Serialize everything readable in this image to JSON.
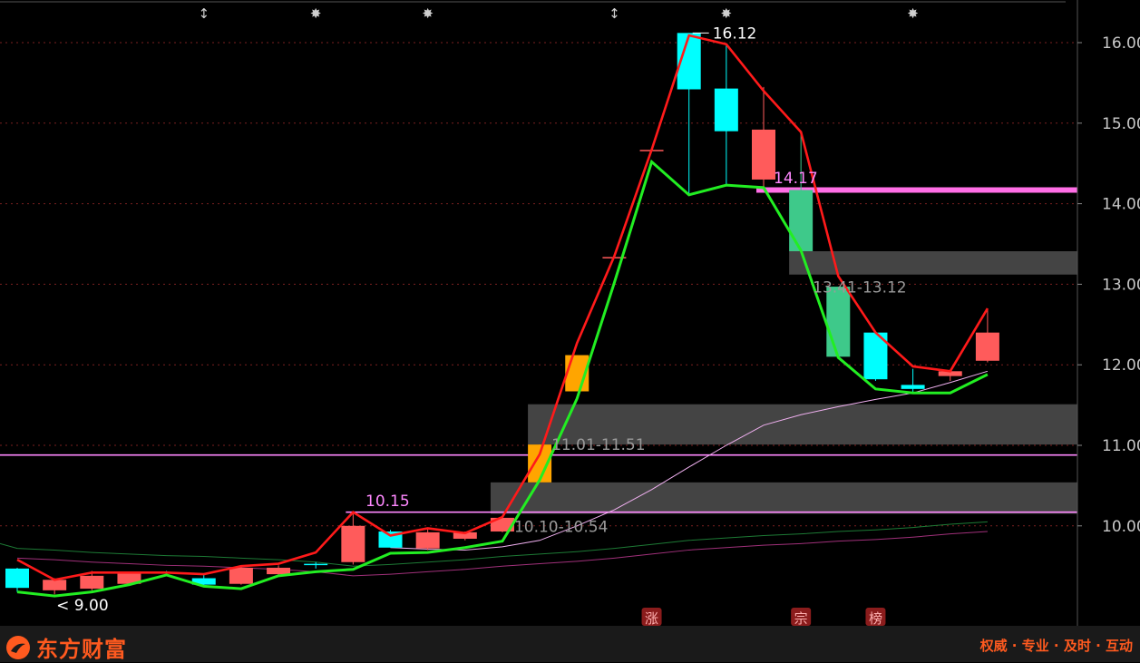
{
  "chart_data": {
    "type": "candlestick",
    "ylim": [
      9.0,
      16.5
    ],
    "y_ticks": [
      "16.00",
      "15.00",
      "14.00",
      "13.00",
      "12.00",
      "11.00",
      "10.00"
    ],
    "y_tick_values": [
      16,
      15,
      14,
      13,
      12,
      11,
      10
    ],
    "candles": [
      {
        "o": 9.23,
        "h": 9.48,
        "l": 9.18,
        "c": 9.47,
        "color": "cyan"
      },
      {
        "o": 9.2,
        "h": 9.35,
        "l": 9.15,
        "c": 9.33,
        "color": "red"
      },
      {
        "o": 9.22,
        "h": 9.44,
        "l": 9.2,
        "c": 9.38,
        "color": "red"
      },
      {
        "o": 9.28,
        "h": 9.42,
        "l": 9.27,
        "c": 9.42,
        "color": "red"
      },
      {
        "o": 9.42,
        "h": 9.44,
        "l": 9.4,
        "c": 9.4,
        "color": "cyan"
      },
      {
        "o": 9.35,
        "h": 9.4,
        "l": 9.24,
        "c": 9.27,
        "color": "cyan"
      },
      {
        "o": 9.28,
        "h": 9.5,
        "l": 9.27,
        "c": 9.48,
        "color": "red"
      },
      {
        "o": 9.4,
        "h": 9.51,
        "l": 9.38,
        "c": 9.48,
        "color": "red"
      },
      {
        "o": 9.52,
        "h": 9.55,
        "l": 9.47,
        "c": 9.5,
        "color": "cyan"
      },
      {
        "o": 9.55,
        "h": 10.15,
        "l": 9.52,
        "c": 10.0,
        "color": "red"
      },
      {
        "o": 9.93,
        "h": 9.95,
        "l": 9.73,
        "c": 9.73,
        "color": "cyan"
      },
      {
        "o": 9.72,
        "h": 9.98,
        "l": 9.7,
        "c": 9.92,
        "color": "red"
      },
      {
        "o": 9.84,
        "h": 9.93,
        "l": 9.82,
        "c": 9.92,
        "color": "red"
      },
      {
        "o": 9.93,
        "h": 10.12,
        "l": 9.92,
        "c": 10.1,
        "color": "red"
      },
      {
        "o": 10.54,
        "h": 11.01,
        "l": 10.54,
        "c": 11.01,
        "color": "orange"
      },
      {
        "o": 11.67,
        "h": 12.12,
        "l": 11.67,
        "c": 12.12,
        "color": "orange"
      },
      {
        "o": 13.33,
        "h": 13.33,
        "l": 13.33,
        "c": 13.33,
        "color": "red"
      },
      {
        "o": 14.66,
        "h": 14.66,
        "l": 14.66,
        "c": 14.66,
        "color": "red"
      },
      {
        "o": 16.12,
        "h": 16.12,
        "l": 14.11,
        "c": 15.42,
        "color": "cyan"
      },
      {
        "o": 15.43,
        "h": 15.98,
        "l": 14.23,
        "c": 14.9,
        "color": "cyan"
      },
      {
        "o": 14.3,
        "h": 15.45,
        "l": 14.2,
        "c": 14.92,
        "color": "red"
      },
      {
        "o": 14.17,
        "h": 14.89,
        "l": 13.41,
        "c": 13.41,
        "color": "green"
      },
      {
        "o": 12.97,
        "h": 12.97,
        "l": 12.1,
        "c": 12.1,
        "color": "green"
      },
      {
        "o": 12.4,
        "h": 12.4,
        "l": 11.8,
        "c": 11.82,
        "color": "cyan"
      },
      {
        "o": 11.75,
        "h": 11.95,
        "l": 11.65,
        "c": 11.7,
        "color": "cyan"
      },
      {
        "o": 11.86,
        "h": 11.92,
        "l": 11.8,
        "c": 11.92,
        "color": "red"
      },
      {
        "o": 12.05,
        "h": 12.7,
        "l": 12.03,
        "c": 12.4,
        "color": "red"
      }
    ],
    "upper_band": [
      9.58,
      9.33,
      9.42,
      9.42,
      9.42,
      9.4,
      9.5,
      9.53,
      9.67,
      10.17,
      9.88,
      9.97,
      9.91,
      10.11,
      10.89,
      12.27,
      13.35,
      14.67,
      16.09,
      15.98,
      15.4,
      14.89,
      13.1,
      12.4,
      11.98,
      11.92,
      12.7
    ],
    "lower_band": [
      9.18,
      9.13,
      9.18,
      9.27,
      9.39,
      9.25,
      9.22,
      9.38,
      9.43,
      9.46,
      9.66,
      9.67,
      9.73,
      9.81,
      10.57,
      11.58,
      13.02,
      14.52,
      14.11,
      14.23,
      14.2,
      13.42,
      12.09,
      11.7,
      11.65,
      11.65,
      11.88
    ],
    "ma_short_start_index": 10,
    "ma_short": [
      9.73,
      9.71,
      9.7,
      9.74,
      9.82,
      10.0,
      10.2,
      10.45,
      10.73,
      11.0,
      11.25,
      11.38,
      11.48,
      11.57,
      11.65,
      11.78,
      11.92
    ],
    "ma_long": [
      9.72,
      9.7,
      9.67,
      9.65,
      9.63,
      9.62,
      9.6,
      9.58,
      9.55,
      9.5,
      9.52,
      9.55,
      9.58,
      9.62,
      9.65,
      9.68,
      9.72,
      9.77,
      9.82,
      9.85,
      9.88,
      9.9,
      9.93,
      9.95,
      9.98,
      10.02,
      10.05
    ],
    "horizontal_lines": [
      {
        "value": 10.88,
        "color": "#ff88ff"
      },
      {
        "value": 10.17,
        "color": "#ff88ff"
      },
      {
        "value": 14.17,
        "color": "#ff6ee6"
      }
    ],
    "zones": [
      {
        "top": 11.51,
        "bottom": 11.01,
        "start_index": 14,
        "label": "11.01-11.51"
      },
      {
        "top": 10.54,
        "bottom": 10.15,
        "start_index": 13,
        "label": "10.10-10.54"
      },
      {
        "top": 13.41,
        "bottom": 13.12,
        "start_index": 21,
        "label": "13.41-13.12"
      }
    ],
    "annotations": [
      {
        "text": "16.12",
        "value": 16.12,
        "index": 18
      },
      {
        "text": "9.00",
        "value": 9.0,
        "index": 1
      },
      {
        "text": "10.15",
        "value": 10.15,
        "index": 9
      },
      {
        "text": "14.17",
        "value": 14.17,
        "index": 20
      }
    ],
    "top_markers": [
      {
        "symbol": "↕",
        "index": 5
      },
      {
        "symbol": "✸",
        "index": 8
      },
      {
        "symbol": "✸",
        "index": 11
      },
      {
        "symbol": "↕",
        "index": 16
      },
      {
        "symbol": "✸",
        "index": 19
      },
      {
        "symbol": "✸",
        "index": 24
      }
    ],
    "bottom_tags": [
      {
        "text": "涨",
        "index": 17
      },
      {
        "text": "宗",
        "index": 21
      },
      {
        "text": "榜",
        "index": 23
      }
    ]
  },
  "footer": {
    "brand_name": "东方财富",
    "slogan": "权威 · 专业 · 及时 · 互动"
  },
  "colors": {
    "background": "#000000",
    "up": "#ff5b5b",
    "down_cyan": "#00ffff",
    "limit_up": "#ffa500",
    "down_green": "#3ec98a",
    "upper_band": "#ff1a1a",
    "lower_band": "#22ee22",
    "brand": "#ff5a1f"
  }
}
